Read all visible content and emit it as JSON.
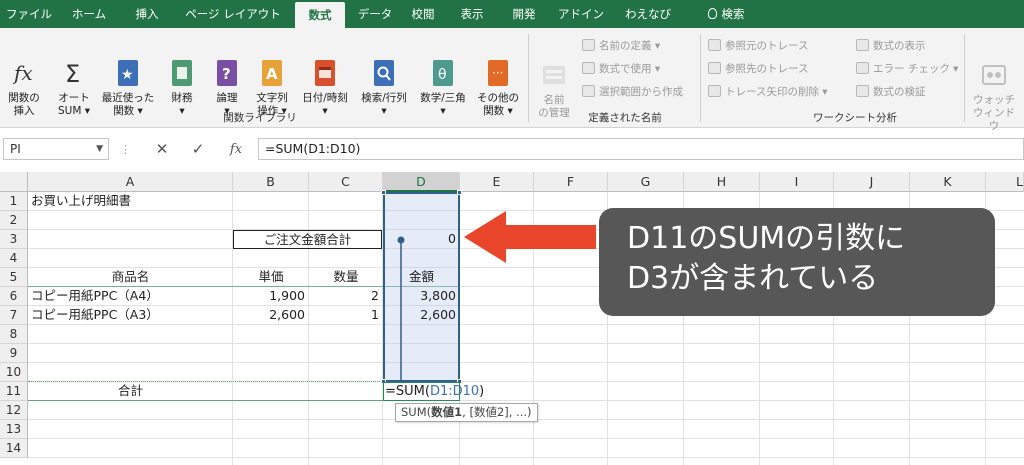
{
  "ribbon_tabs": [
    {
      "label": "ファイル",
      "active": false
    },
    {
      "label": "ホーム",
      "active": false
    },
    {
      "label": "挿入",
      "active": false
    },
    {
      "label": "ページ レイアウト",
      "active": false
    },
    {
      "label": "数式",
      "active": true
    },
    {
      "label": "データ",
      "active": false
    },
    {
      "label": "校閲",
      "active": false
    },
    {
      "label": "表示",
      "active": false
    },
    {
      "label": "開発",
      "active": false
    },
    {
      "label": "アドイン",
      "active": false
    },
    {
      "label": "わえなび",
      "active": false
    },
    {
      "label": "検索",
      "active": false
    }
  ],
  "ribbon": {
    "function_library": {
      "group_label": "関数ライブラリ",
      "buttons": [
        {
          "label": "関数の\n挿入",
          "icon": "fx-icon"
        },
        {
          "label": "オート\nSUM ▾",
          "icon": "sigma-icon"
        },
        {
          "label": "最近使った\n関数 ▾",
          "icon": "star-book-icon"
        },
        {
          "label": "財務\n▾",
          "icon": "finance-book-icon"
        },
        {
          "label": "論理\n▾",
          "icon": "logic-book-icon"
        },
        {
          "label": "文字列\n操作 ▾",
          "icon": "text-book-icon"
        },
        {
          "label": "日付/時刻\n▾",
          "icon": "calendar-book-icon"
        },
        {
          "label": "検索/行列\n▾",
          "icon": "lookup-book-icon"
        },
        {
          "label": "数学/三角\n▾",
          "icon": "math-book-icon"
        },
        {
          "label": "その他の\n関数 ▾",
          "icon": "more-book-icon"
        }
      ]
    },
    "defined_names": {
      "group_label": "定義された名前",
      "big_button": "名前\nの管理",
      "items": [
        "名前の定義 ▾",
        "数式で使用 ▾",
        "選択範囲から作成"
      ]
    },
    "formula_auditing": {
      "group_label": "ワークシート分析",
      "items": [
        "参照元のトレース",
        "参照先のトレース",
        "トレース矢印の削除 ▾",
        "数式の表示",
        "エラー チェック ▾",
        "数式の検証"
      ],
      "watch_window": "ウォッチ\nウィンドウ"
    }
  },
  "formula_bar": {
    "name_box": "PI",
    "cancel": "✕",
    "enter": "✓",
    "fx": "fx",
    "formula": "=SUM(D1:D10)"
  },
  "grid": {
    "columns": [
      "A",
      "B",
      "C",
      "D",
      "E",
      "F",
      "G",
      "H",
      "I",
      "J",
      "K",
      "L"
    ],
    "rows": [
      "1",
      "2",
      "3",
      "4",
      "5",
      "6",
      "7",
      "8",
      "9",
      "10",
      "11",
      "12",
      "13",
      "14"
    ],
    "selected_column": "D"
  },
  "cells": {
    "A1": "お買い上げ明細書",
    "B3": "ご注文金額合計",
    "D3": "0",
    "A5": "商品名",
    "B5": "単価",
    "C5": "数量",
    "D5": "金額",
    "A6": "コピー用紙PPC（A4）",
    "B6": "1,900",
    "C6": "2",
    "D6": "3,800",
    "A7": "コピー用紙PPC（A3）",
    "B7": "2,600",
    "C7": "1",
    "D7": "2,600",
    "A11": "合計"
  },
  "edit": {
    "prefix": "=SUM(",
    "range": "D1:D10",
    "suffix": ")",
    "tooltip_fn": "SUM(",
    "tooltip_arg1": "数値1",
    "tooltip_rest": ", [数値2], ...)"
  },
  "annotation": {
    "text": "D11のSUMの引数に\nD3が含まれている",
    "arrow_color": "#e8452a",
    "box_color": "#575757"
  },
  "colors": {
    "accent": "#217346",
    "range_border": "#2f5f8a",
    "ref_text": "#3d6fb6"
  }
}
